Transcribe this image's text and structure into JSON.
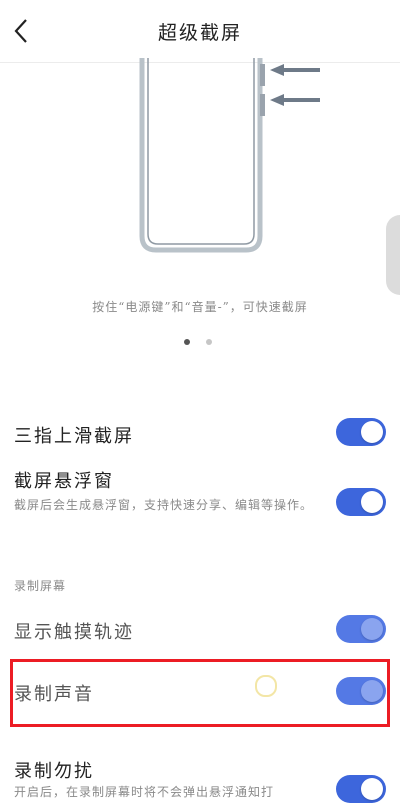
{
  "header": {
    "title": "超级截屏"
  },
  "illustration": {
    "caption": "按住“电源键”和“音量-”，可快速截屏"
  },
  "pager": {
    "page_count": 2,
    "active_page": 1
  },
  "settings": {
    "three_finger": {
      "label": "三指上滑截屏",
      "enabled": true
    },
    "floating_window": {
      "label": "截屏悬浮窗",
      "desc": "截屏后会生成悬浮窗，支持快速分享、编辑等操作。",
      "enabled": true
    },
    "section_record": "录制屏幕",
    "show_touches": {
      "label": "显示触摸轨迹",
      "enabled": true
    },
    "record_audio": {
      "label": "录制声音",
      "enabled": true
    },
    "record_no_disturb": {
      "label": "录制勿扰",
      "desc": "开启后，在录制屏幕时将不会弹出悬浮通知打",
      "enabled": true
    }
  },
  "colors": {
    "accent": "#3d66dc",
    "highlight": "#ec1c24",
    "arrow": "#6e7a88"
  },
  "icons": {
    "back": "chevron-left-icon",
    "phone": "phone-outline-icon",
    "arrows": "arrow-left-icon"
  }
}
